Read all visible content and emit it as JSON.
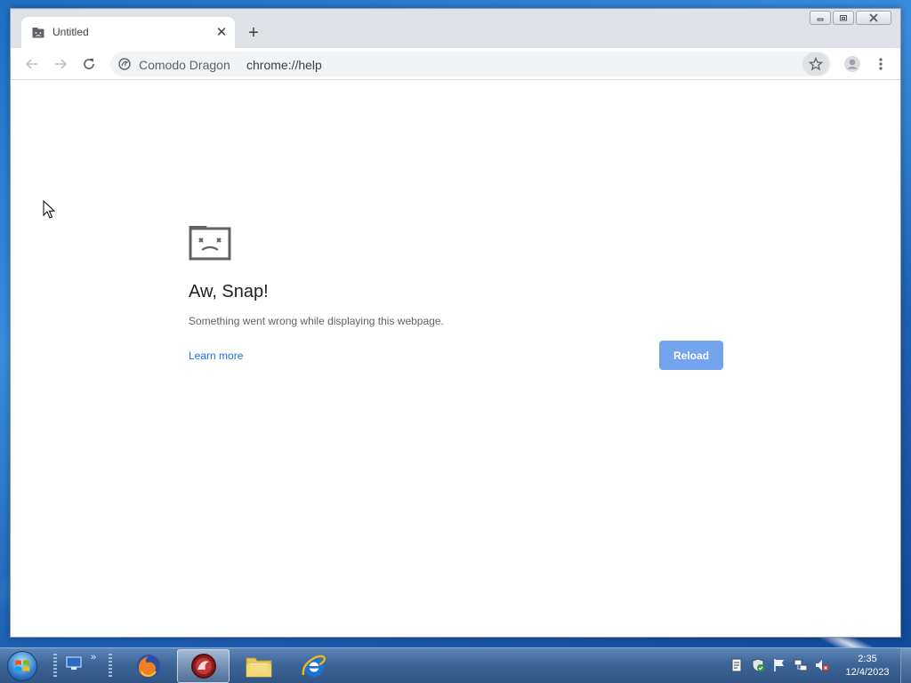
{
  "browser": {
    "tab": {
      "title": "Untitled",
      "close_glyph": "✕",
      "favicon": "sad-tab-icon"
    },
    "new_tab_glyph": "+",
    "window_controls": {
      "minimize": "—",
      "maximize": "▭",
      "close": "✕"
    },
    "omnibox": {
      "brand": "Comodo Dragon",
      "url": "chrome://help",
      "brand_icon": "dragon-icon"
    },
    "icons": {
      "back": "back-arrow-icon",
      "forward": "forward-arrow-icon",
      "reload": "reload-icon",
      "bookmark": "star-icon",
      "profile": "profile-icon",
      "menu": "kebab-menu-icon"
    }
  },
  "page": {
    "error_title": "Aw, Snap!",
    "error_message": "Something went wrong while displaying this webpage.",
    "learn_more": "Learn more",
    "reload_label": "Reload",
    "reload_color": "#75a4ee",
    "link_color": "#1a73e8"
  },
  "taskbar": {
    "start_icon": "windows-orb-icon",
    "quick_launch": [
      "show-desktop-icon"
    ],
    "pinned": [
      {
        "name": "firefox",
        "icon": "firefox-icon"
      },
      {
        "name": "comodo-dragon",
        "icon": "dragon-icon",
        "active": true
      },
      {
        "name": "file-explorer",
        "icon": "folder-icon"
      },
      {
        "name": "internet-explorer",
        "icon": "ie-icon"
      }
    ],
    "tray": [
      "notes-icon",
      "security-shield-icon",
      "action-center-flag-icon",
      "network-icon",
      "volume-muted-icon"
    ],
    "clock": {
      "time": "2:35",
      "date": "12/4/2023"
    }
  }
}
